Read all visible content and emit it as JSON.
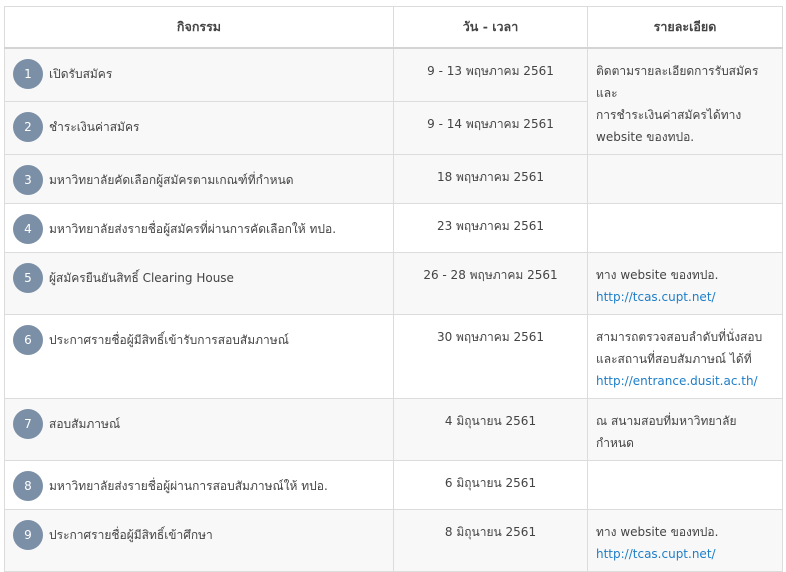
{
  "headers": {
    "activity": "กิจกรรม",
    "datetime": "วัน - เวลา",
    "details": "รายละเอียด"
  },
  "rows": [
    {
      "num": "1",
      "activity": "เปิดรับสมัคร",
      "date": "9 - 13 พฤษภาคม 2561"
    },
    {
      "num": "2",
      "activity": "ชำระเงินค่าสมัคร",
      "date": "9 - 14 พฤษภาคม 2561"
    },
    {
      "num": "3",
      "activity": "มหาวิทยาลัยคัดเลือกผู้สมัครตามเกณฑ์ที่กำหนด",
      "date": "18 พฤษภาคม 2561"
    },
    {
      "num": "4",
      "activity": "มหาวิทยาลัยส่งรายชื่อผู้สมัครที่ผ่านการคัดเลือกให้ ทปอ.",
      "date": "23 พฤษภาคม 2561"
    },
    {
      "num": "5",
      "activity": "ผู้สมัครยืนยันสิทธิ์ Clearing House",
      "date": "26 - 28 พฤษภาคม 2561"
    },
    {
      "num": "6",
      "activity": "ประกาศรายชื่อผู้มีสิทธิ์เข้ารับการสอบสัมภาษณ์",
      "date": "30 พฤษภาคม 2561"
    },
    {
      "num": "7",
      "activity": "สอบสัมภาษณ์",
      "date": "4  มิถุนายน 2561"
    },
    {
      "num": "8",
      "activity": "มหาวิทยาลัยส่งรายชื่อผู้ผ่านการสอบสัมภาษณ์ให้ ทปอ.",
      "date": "6 มิถุนายน 2561"
    },
    {
      "num": "9",
      "activity": "ประกาศรายชื่อผู้มีสิทธิ์เข้าศึกษา",
      "date": "8 มิถุนายน 2561"
    }
  ],
  "details": {
    "r1_l1": "ติดตามรายละเอียดการรับสมัคร และ",
    "r1_l2": "การชำระเงินค่าสมัครได้ทาง",
    "r1_l3": "website ของทปอ.",
    "r5_l1": "ทาง website ของทปอ.",
    "r5_link": "http://tcas.cupt.net/",
    "r6_l1": "สามารถตรวจสอบลำดับที่นั่งสอบ",
    "r6_l2": "และสถานที่สอบสัมภาษณ์ ได้ที่",
    "r6_link": "http://entrance.dusit.ac.th/",
    "r7_l1": "ณ สนามสอบที่มหาวิทยาลัยกำหนด",
    "r9_l1": "ทาง website ของทปอ.",
    "r9_link": "http://tcas.cupt.net/"
  }
}
